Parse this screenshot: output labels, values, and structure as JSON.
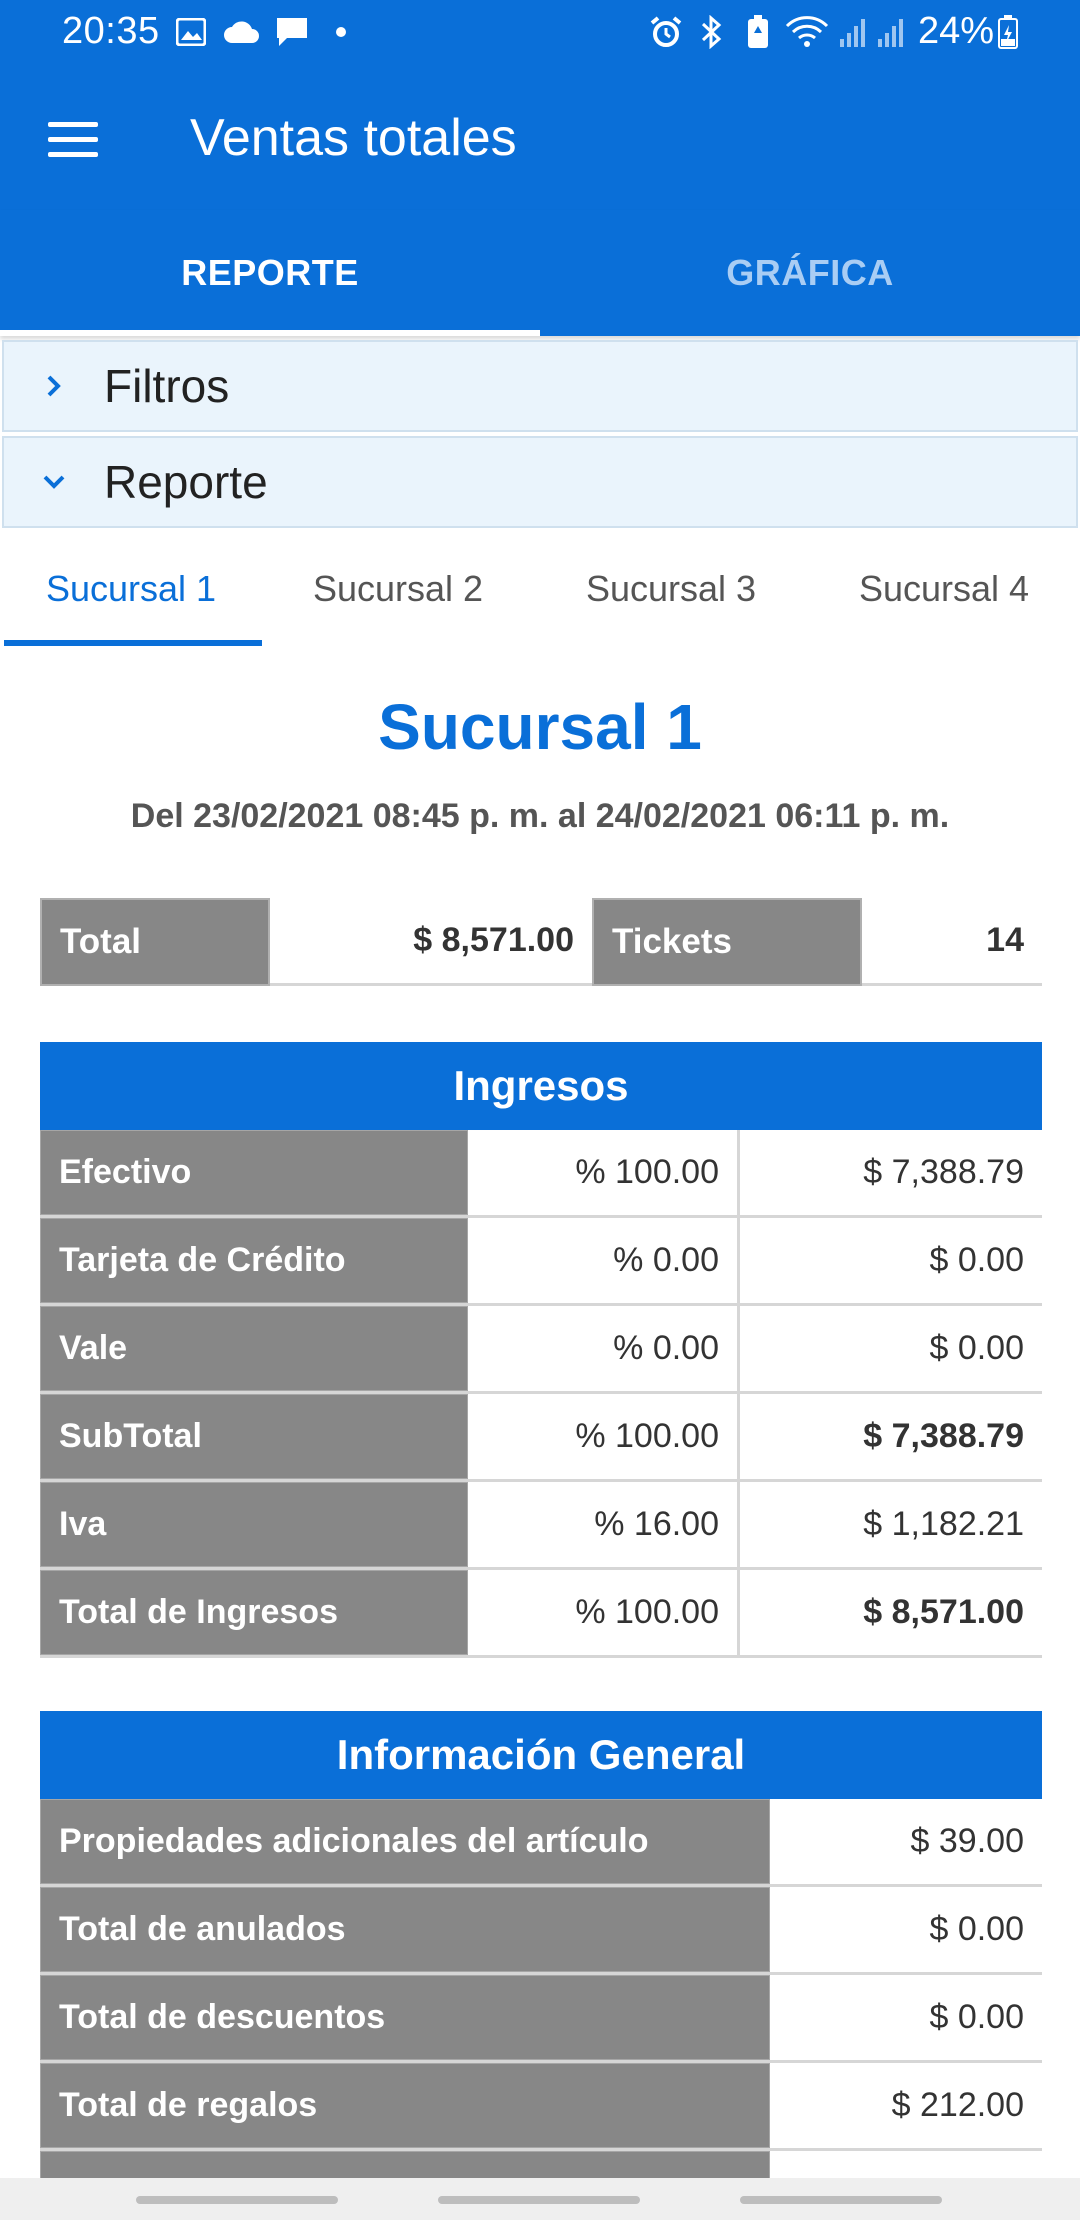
{
  "status_bar": {
    "time": "20:35",
    "battery": "24%",
    "icons": [
      "image-icon",
      "cloud-icon",
      "chat-icon",
      "dot-icon",
      "alarm-icon",
      "bluetooth-icon",
      "battery-saver-icon",
      "wifi-icon",
      "signal-icon",
      "signal-icon",
      "battery-icon"
    ]
  },
  "app_bar": {
    "title": "Ventas totales"
  },
  "main_tabs": [
    {
      "label": "REPORTE",
      "active": true
    },
    {
      "label": "GRÁFICA",
      "active": false
    }
  ],
  "accordions": {
    "filters": {
      "label": "Filtros",
      "expanded": false
    },
    "report": {
      "label": "Reporte",
      "expanded": true
    }
  },
  "branch_tabs": [
    {
      "label": "Sucursal 1",
      "active": true
    },
    {
      "label": "Sucursal 2",
      "active": false
    },
    {
      "label": "Sucursal 3",
      "active": false
    },
    {
      "label": "Sucursal 4",
      "active": false
    }
  ],
  "branch": {
    "title": "Sucursal 1",
    "date_range": "Del 23/02/2021 08:45 p. m. al 24/02/2021 06:11 p. m."
  },
  "summary": {
    "total_label": "Total",
    "total_value": "$ 8,571.00",
    "tickets_label": "Tickets",
    "tickets_value": "14"
  },
  "income": {
    "title": "Ingresos",
    "rows": [
      {
        "name": "Efectivo",
        "percent": "% 100.00",
        "amount": "$ 7,388.79"
      },
      {
        "name": "Tarjeta de Crédito",
        "percent": "% 0.00",
        "amount": "$ 0.00"
      },
      {
        "name": "Vale",
        "percent": "% 0.00",
        "amount": "$ 0.00"
      },
      {
        "name": "SubTotal",
        "percent": "% 100.00",
        "amount": "$ 7,388.79"
      },
      {
        "name": "Iva",
        "percent": "% 16.00",
        "amount": "$ 1,182.21"
      },
      {
        "name": "Total de Ingresos",
        "percent": "% 100.00",
        "amount": "$ 8,571.00"
      }
    ]
  },
  "general_info": {
    "title": "Información General",
    "rows": [
      {
        "name": "Propiedades adicionales del artículo",
        "amount": "$ 39.00"
      },
      {
        "name": "Total de anulados",
        "amount": "$ 0.00"
      },
      {
        "name": "Total de descuentos",
        "amount": "$ 0.00"
      },
      {
        "name": "Total de regalos",
        "amount": "$ 212.00"
      }
    ]
  },
  "colors": {
    "primary": "#0a6fd8",
    "header_cell": "#878787",
    "accordion_bg": "#eaf4fc"
  }
}
